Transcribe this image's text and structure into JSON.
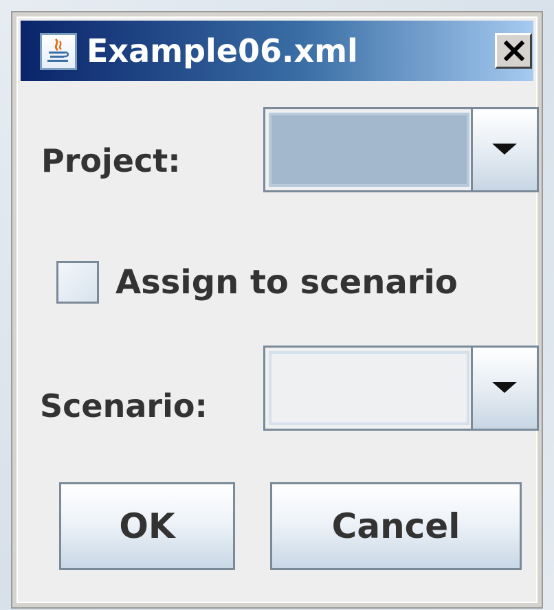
{
  "window": {
    "title": "Example06.xml",
    "icon": "java-cup-icon",
    "close_symbol": "X"
  },
  "form": {
    "project_label": "Project:",
    "project_value": "",
    "assign_checkbox_label": "Assign to scenario",
    "assign_checked": false,
    "scenario_label": "Scenario:",
    "scenario_value": ""
  },
  "buttons": {
    "ok_label": "OK",
    "cancel_label": "Cancel"
  },
  "colors": {
    "titlebar_start": "#0a246a",
    "titlebar_end": "#a6caf0",
    "dialog_background": "#eeeeee",
    "selected_field": "#a3b8cc"
  }
}
